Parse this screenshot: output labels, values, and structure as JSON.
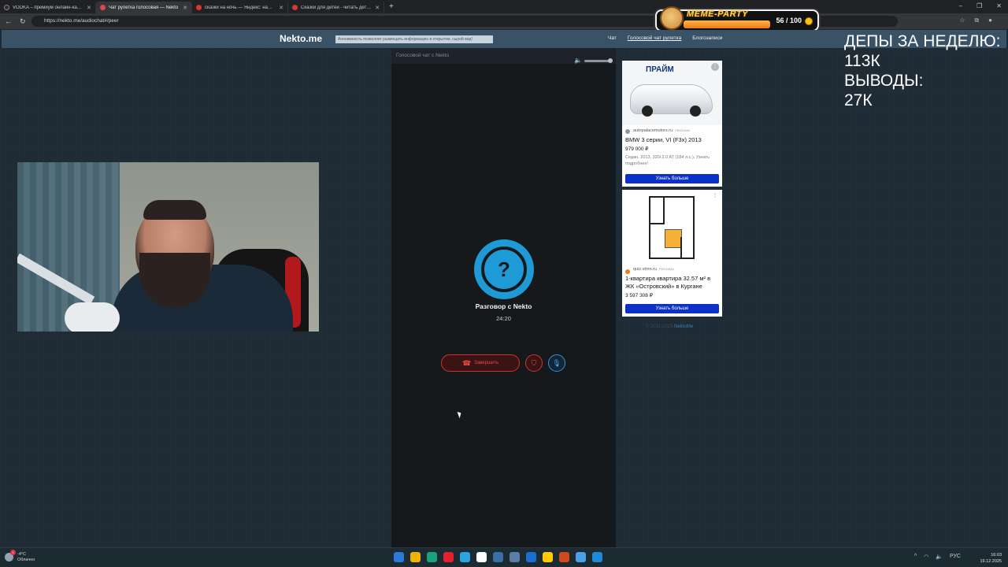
{
  "browser": {
    "tabs": [
      {
        "title": "VODKA – премиум онлайн-казино",
        "color": "#2b2b2b",
        "active": false
      },
      {
        "title": "Чат рулетка голосовая — Nekto",
        "color": "#3aa0e0",
        "active": true
      },
      {
        "title": "сказки на ночь — Яндекс: нашлось",
        "color": "#e03434",
        "active": false
      },
      {
        "title": "Сказки для детей - читать детские",
        "color": "#d03a3a",
        "active": false
      }
    ],
    "url": "https://nekto.me/audiochat#/peer",
    "meme_counter": "56 / 100",
    "meme_brand": "MEME-PARTY"
  },
  "site": {
    "logo": "Nekto.me",
    "anon_note": "Анонимность позволяет размещать информацию в открытом, сырой вид!",
    "nav": [
      "Чат",
      "Голосовой чат рулетка",
      "Блогозаписи"
    ]
  },
  "overlay": {
    "line1": "ДЕПЫ ЗА НЕДЕЛЮ:",
    "line2": "113К",
    "line3": "ВЫВОДЫ:",
    "line4": "27К"
  },
  "chat": {
    "header": "Голосовой чат с Nekto",
    "avatar_symbol": "?",
    "title": "Разговор с Nekto",
    "timer": "24:20",
    "end_label": "Завершить"
  },
  "ads": [
    {
      "brand": "ПРАЙМ",
      "source": "autopalacemotors.ru",
      "tag": "РЕКЛАМА",
      "headline": "BMW 3 серии, VI (F3x) 2013",
      "price": "979 000 ₽",
      "desc": "Седан, 2013, 320i 2.0 AT (184 л.с.). Узнать подробнее!",
      "cta": "Узнать больше"
    },
    {
      "source": "quiz.vtmn.ru",
      "tag": "РЕКЛАМА",
      "headline": "1-квартира квартира 32.57 м² в ЖК «Островский» в Кургане",
      "price": "3 597 308 ₽",
      "cta": "Узнать больше"
    }
  ],
  "footer": {
    "copyright": "© 2011-2025",
    "link": "NektoMe"
  },
  "taskbar": {
    "weather_temp": "-4°C",
    "weather_desc": "Облачно",
    "lang": "РУС",
    "time": "16:03",
    "date": "19.12.2025",
    "icons": [
      "#2b79d8",
      "#f0b400",
      "#1aa37a",
      "#e5202e",
      "#2aa5e0",
      "#ffffff",
      "#3a6ea5",
      "#5a7fa6",
      "#1b6fd0",
      "#ffcc00",
      "#d14a1c",
      "#4aa0e0",
      "#1f8ad8"
    ]
  }
}
